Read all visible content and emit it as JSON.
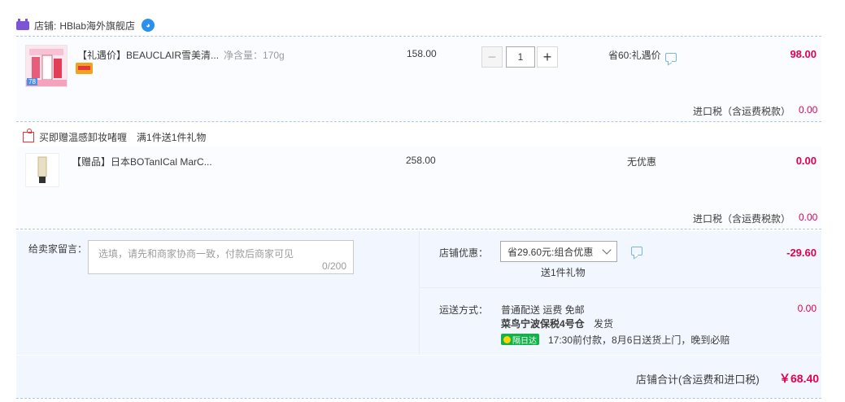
{
  "shop": {
    "label": "店铺:",
    "name": "HBlab海外旗舰店"
  },
  "items": [
    {
      "name": "【礼遇价】BEAUCLAIR雪美清...",
      "spec": "净含量：170g",
      "price": "158.00",
      "qty": "1",
      "promo": "省60:礼遇价",
      "subtotal": "98.00",
      "thumb_badge": "78"
    },
    {
      "name": "【赠品】日本BOTanICal MarC...",
      "price": "258.00",
      "promo": "无优惠",
      "subtotal": "0.00"
    }
  ],
  "tax": {
    "label": "进口税（含运费税款）",
    "value1": "0.00",
    "value2": "0.00"
  },
  "gift": {
    "title": "买即赠温感卸妆啫喱",
    "rule": "满1件送1件礼物"
  },
  "message": {
    "label": "给卖家留言：",
    "placeholder": "选填，请先和商家协商一致，付款后商家可见",
    "counter": "0/200"
  },
  "discount": {
    "label": "店铺优惠：",
    "selected": "省29.60元:组合优惠",
    "note": "送1件礼物",
    "value": "-29.60"
  },
  "shipping": {
    "label": "运送方式：",
    "method": "普通配送 运费 免邮",
    "warehouse": "菜鸟宁波保税4号仓",
    "dispatch": "发货",
    "badge": "隔日达",
    "promise": "17:30前付款，8月6日送货上门，晚到必赔",
    "value": "0.00"
  },
  "total": {
    "label": "店铺合计(含运费和进口税)",
    "value": "￥68.40"
  },
  "colors": {
    "accent": "#e4004f",
    "line": "#a9c8e8",
    "panel": "#f2f7ff"
  }
}
